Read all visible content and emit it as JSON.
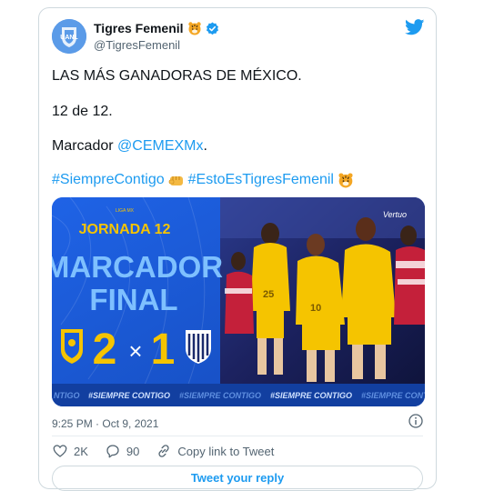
{
  "tweet": {
    "display_name": "Tigres Femenil",
    "handle": "@TigresFemenil",
    "line1": "LAS MÁS GANADORAS DE MÉXICO.",
    "line2": "12 de 12.",
    "line3_prefix": "Marcador ",
    "line3_mention": "@CEMEXMx",
    "line3_suffix": ".",
    "hashtag1": "#SiempreContigo",
    "hashtag2": "#EstoEsTigresFemenil",
    "timestamp": "9:25 PM · Oct 9, 2021"
  },
  "media": {
    "league": "LIGA MX",
    "jornada": "JORNADA 12",
    "title_line1": "MARCADOR",
    "title_line2": "FINAL",
    "score_home": "2",
    "score_sep": "×",
    "score_away": "1",
    "ticker": [
      "NTIGO",
      "#SIEMPRE CONTIGO",
      "#SIEMPRE CONTIGO",
      "#SIEMPRE CONTIGO",
      "#SIEMPRE CONTIGO",
      "#SIEMPRE CONTIGO"
    ],
    "brand": "Vertuo"
  },
  "actions": {
    "likes": "2K",
    "replies": "90",
    "copy_link": "Copy link to Tweet",
    "reply_button": "Tweet your reply"
  },
  "colors": {
    "link": "#1d9bf0",
    "media_blue": "#1a5bd8",
    "gold": "#f5c400"
  },
  "icons": [
    "tiger-emoji-icon",
    "verified-icon",
    "twitter-bird-icon",
    "fist-emoji-icon",
    "info-icon",
    "heart-icon",
    "reply-icon",
    "link-icon"
  ]
}
